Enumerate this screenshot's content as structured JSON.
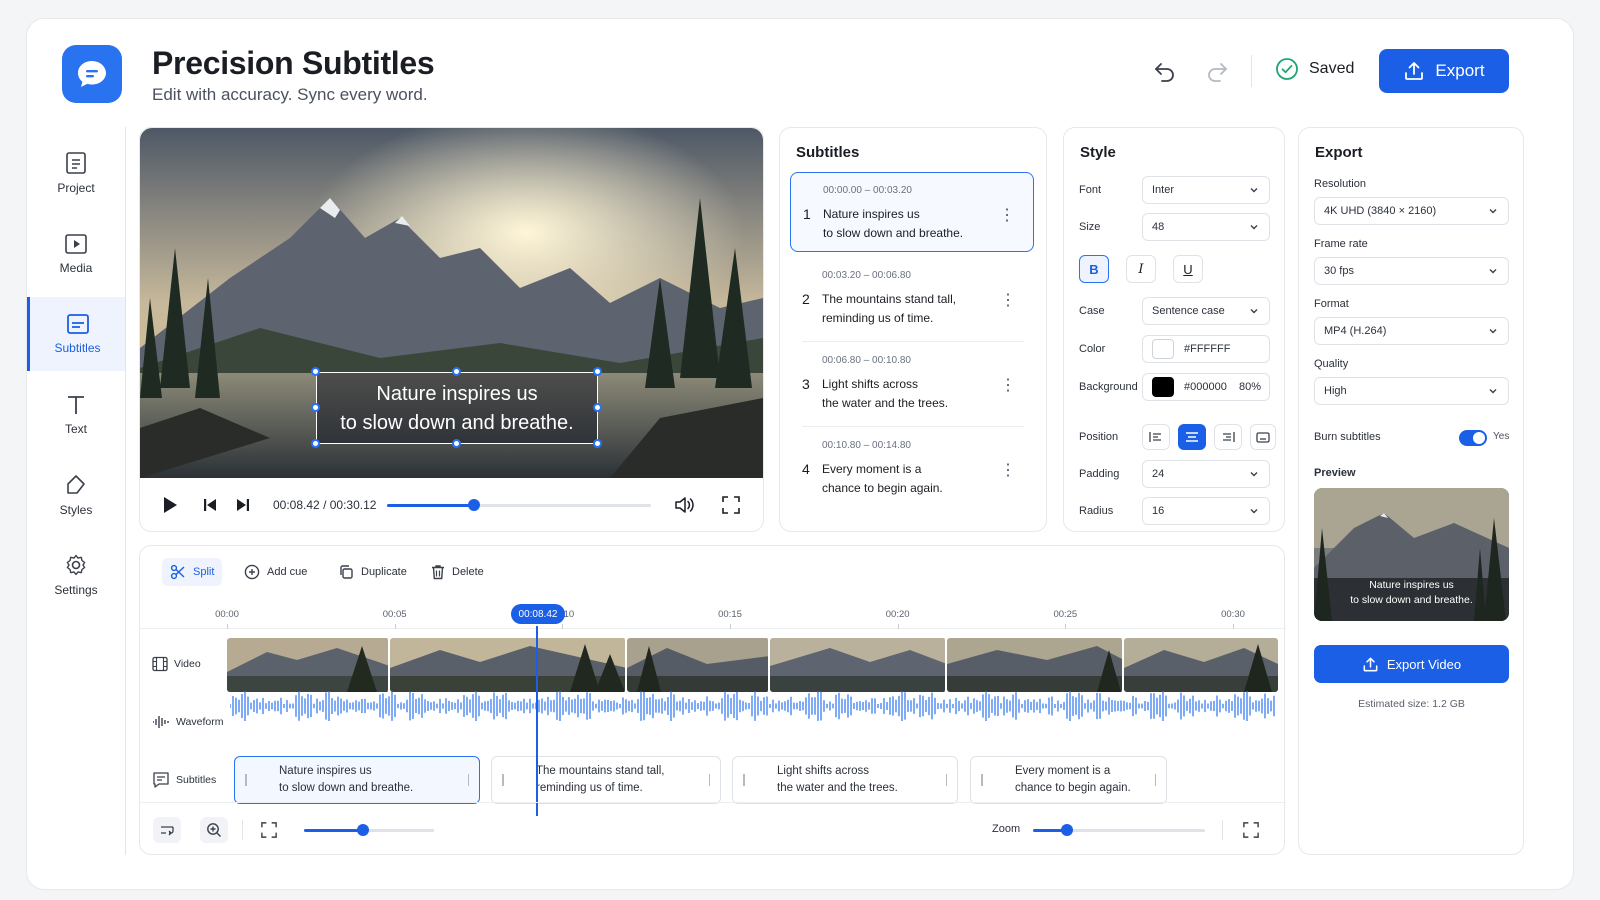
{
  "app": {
    "title": "Precision Subtitles",
    "subtitle": "Edit with accuracy. Sync every word.",
    "saved_label": "Saved",
    "export_label": "Export"
  },
  "colors": {
    "accent": "#1a5fe6",
    "border": "#e6e8ec"
  },
  "sidebar": {
    "items": [
      {
        "label": "Project",
        "icon": "project-icon"
      },
      {
        "label": "Media",
        "icon": "media-icon"
      },
      {
        "label": "Subtitles",
        "icon": "subtitles-icon",
        "active": true
      },
      {
        "label": "Text",
        "icon": "text-icon"
      },
      {
        "label": "Styles",
        "icon": "styles-icon"
      },
      {
        "label": "Settings",
        "icon": "gear-icon"
      }
    ]
  },
  "player": {
    "caption_line1": "Nature inspires us",
    "caption_line2": "to slow down and breathe.",
    "current_time": "00:08.42",
    "separator": "/",
    "duration": "00:30.12",
    "progress": 0.33
  },
  "subtitles_panel": {
    "title": "Subtitles",
    "cues": [
      {
        "num": "1",
        "time": "00:00.00 – 00:03.20",
        "line1": "Nature inspires us",
        "line2": "to slow down and breathe."
      },
      {
        "num": "2",
        "time": "00:03.20 – 00:06.80",
        "line1": "The mountains stand tall,",
        "line2": "reminding us of time."
      },
      {
        "num": "3",
        "time": "00:06.80 – 00:10.80",
        "line1": "Light shifts across",
        "line2": "the water and the trees."
      },
      {
        "num": "4",
        "time": "00:10.80 – 00:14.80",
        "line1": "Every moment is a",
        "line2": "chance to begin again."
      }
    ]
  },
  "style_panel": {
    "title": "Style",
    "font_label": "Font",
    "font_value": "Inter",
    "size_label": "Size",
    "size_value": "48",
    "bold": "B",
    "italic": "I",
    "underline": "U",
    "case_label": "Case",
    "case_value": "Sentence case",
    "color_label": "Color",
    "color_value": "#FFFFFF",
    "background_label": "Background",
    "background_value": "#000000",
    "background_opacity": "80%",
    "position_label": "Position",
    "padding_label": "Padding",
    "padding_value": "24",
    "radius_label": "Radius",
    "radius_value": "16"
  },
  "export_panel": {
    "title": "Export",
    "resolution_label": "Resolution",
    "resolution_value": "4K UHD (3840 × 2160)",
    "framerate_label": "Frame rate",
    "framerate_value": "30 fps",
    "format_label": "Format",
    "format_value": "MP4 (H.264)",
    "quality_label": "Quality",
    "quality_value": "High",
    "burn_label": "Burn subtitles",
    "burn_value": "Yes",
    "preview_label": "Preview",
    "preview_line1": "Nature inspires us",
    "preview_line2": "to slow down and breathe.",
    "export_button": "Export Video",
    "estimated_size": "Estimated size: 1.2 GB"
  },
  "timeline": {
    "tools": [
      "Split",
      "Add cue",
      "Duplicate",
      "Delete"
    ],
    "ticks": [
      "00:00",
      "00:05",
      "00:10",
      "00:15",
      "00:20",
      "00:25",
      "00:30"
    ],
    "playhead": "00:08.42",
    "tracks": {
      "video": "Video",
      "waveform": "Waveform",
      "subtitles": "Subtitles"
    },
    "clips": [
      {
        "line1": "Nature inspires us",
        "line2": "to slow down and breathe."
      },
      {
        "line1": "The mountains stand tall,",
        "line2": "reminding us of time."
      },
      {
        "line1": "Light shifts across",
        "line2": "the water and the trees."
      },
      {
        "line1": "Every moment is a",
        "line2": "chance to begin again."
      }
    ],
    "zoom_label": "Zoom",
    "scale_level": 0.45,
    "zoom_level": 0.2
  }
}
